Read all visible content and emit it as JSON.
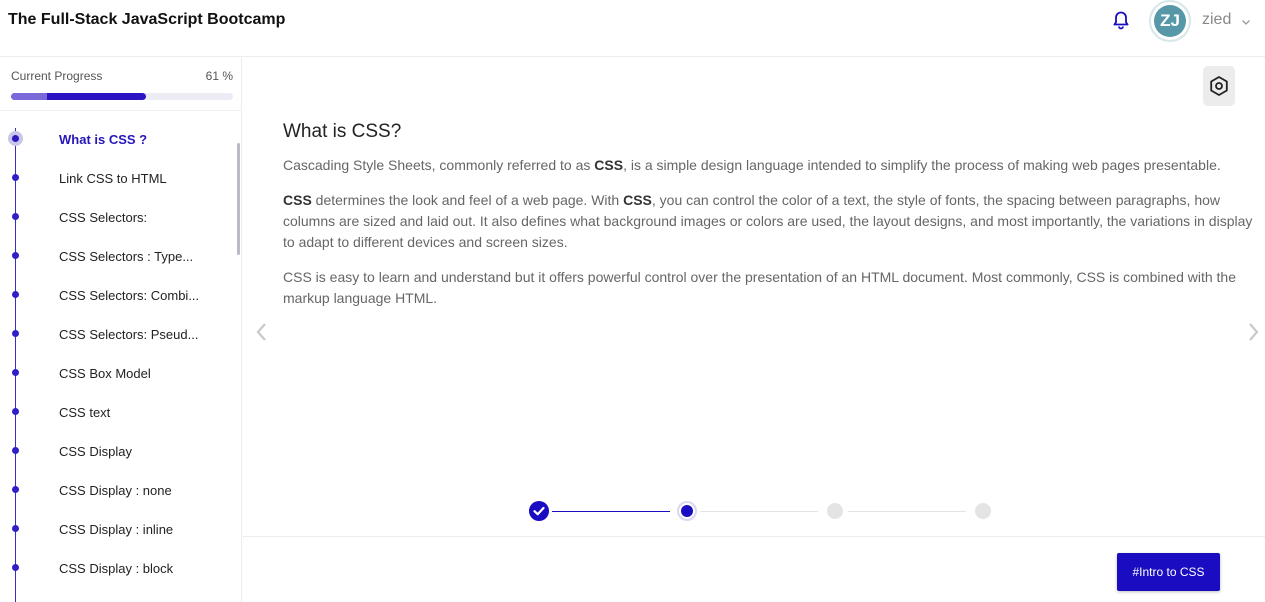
{
  "header": {
    "title": "The Full-Stack JavaScript Bootcamp",
    "bell_icon": "bell-icon",
    "avatar_initials": "ZJ",
    "username": "zied",
    "user_menu_icon": "chevron-down-icon"
  },
  "sidebar": {
    "progress_label": "Current Progress",
    "progress_text": "61 %",
    "progress_value": 0.61,
    "lessons": [
      {
        "label": "What is CSS ?",
        "active": true
      },
      {
        "label": "Link CSS to HTML"
      },
      {
        "label": "CSS Selectors:"
      },
      {
        "label": "CSS Selectors : Type..."
      },
      {
        "label": "CSS Selectors: Combi..."
      },
      {
        "label": "CSS Selectors: Pseud..."
      },
      {
        "label": "CSS Box Model"
      },
      {
        "label": "CSS text"
      },
      {
        "label": "CSS Display"
      },
      {
        "label": "CSS Display : none"
      },
      {
        "label": "CSS Display : inline"
      },
      {
        "label": "CSS Display : block"
      }
    ]
  },
  "main": {
    "settings_icon": "gear-icon",
    "title": "What is CSS?",
    "paragraphs": [
      [
        {
          "text": "Cascading Style Sheets, commonly referred to as "
        },
        {
          "text": "CSS",
          "bold": true
        },
        {
          "text": ", is a simple design language intended to simplify the process of making web pages presentable."
        }
      ],
      [
        {
          "text": "CSS",
          "bold": true
        },
        {
          "text": " determines the look and feel of a web page. With "
        },
        {
          "text": "CSS",
          "bold": true
        },
        {
          "text": ", you can control the color of a text, the style of fonts, the spacing between paragraphs, how columns are sized and laid out. It also defines what background images or colors are used, the layout designs, and most importantly, the variations in display to adapt to different devices and screen sizes."
        }
      ],
      [
        {
          "text": "CSS is easy to learn and understand but it offers powerful control over the presentation of an HTML document. Most commonly, CSS is combined with the markup language HTML."
        }
      ]
    ],
    "prev_icon": "chevron-left-icon",
    "next_icon": "chevron-right-icon",
    "steps": [
      {
        "state": "completed"
      },
      {
        "state": "current"
      },
      {
        "state": "upcoming"
      },
      {
        "state": "upcoming"
      }
    ],
    "footer_button": "#Intro to CSS"
  },
  "colors": {
    "accent": "#1a0cc0",
    "avatar_bg": "#5698a8",
    "step_upcoming": "#e4e4e4"
  }
}
